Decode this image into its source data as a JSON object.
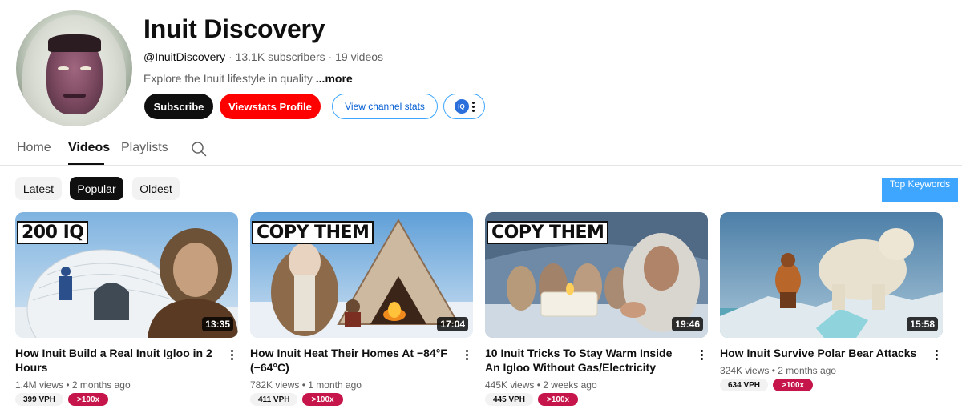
{
  "channel": {
    "name": "Inuit Discovery",
    "handle": "@InuitDiscovery",
    "subscribers": "13.1K subscribers",
    "videos_count": "19 videos",
    "description": "Explore the Inuit lifestyle in quality",
    "more_label": "...more"
  },
  "actions": {
    "subscribe": "Subscribe",
    "viewstats_profile": "Viewstats Profile",
    "view_channel_stats": "View channel stats",
    "iq_badge": "IQ"
  },
  "tabs": [
    "Home",
    "Videos",
    "Playlists"
  ],
  "active_tab": "Videos",
  "chips": [
    "Latest",
    "Popular",
    "Oldest"
  ],
  "active_chip": "Popular",
  "top_keywords_label": "Top Keywords",
  "videos": [
    {
      "thumb_label": "200 IQ",
      "duration": "13:35",
      "title": "How Inuit Build a Real Inuit Igloo in 2 Hours",
      "views": "1.4M views",
      "age": "2 months ago",
      "vph": "399 VPH",
      "multiplier": ">100x"
    },
    {
      "thumb_label": "COPY THEM",
      "duration": "17:04",
      "title": "How Inuit Heat Their Homes At −84°F (−64°C)",
      "views": "782K views",
      "age": "1 month ago",
      "vph": "411 VPH",
      "multiplier": ">100x"
    },
    {
      "thumb_label": "COPY THEM",
      "duration": "19:46",
      "title": "10 Inuit Tricks To Stay Warm Inside An Igloo Without Gas/Electricity",
      "views": "445K views",
      "age": "2 weeks ago",
      "vph": "445 VPH",
      "multiplier": ">100x"
    },
    {
      "thumb_label": "",
      "duration": "15:58",
      "title": "How Inuit Survive Polar Bear Attacks",
      "views": "324K views",
      "age": "2 months ago",
      "vph": "634 VPH",
      "multiplier": ">100x"
    }
  ],
  "meta_separator": "•",
  "colors": {
    "subscribe_bg": "#0f0f0f",
    "viewstats_bg": "#ff0000",
    "stats_border": "#3ea6ff",
    "top_keywords_bg": "#3ea6ff",
    "multiplier_bg": "#c5154a"
  }
}
